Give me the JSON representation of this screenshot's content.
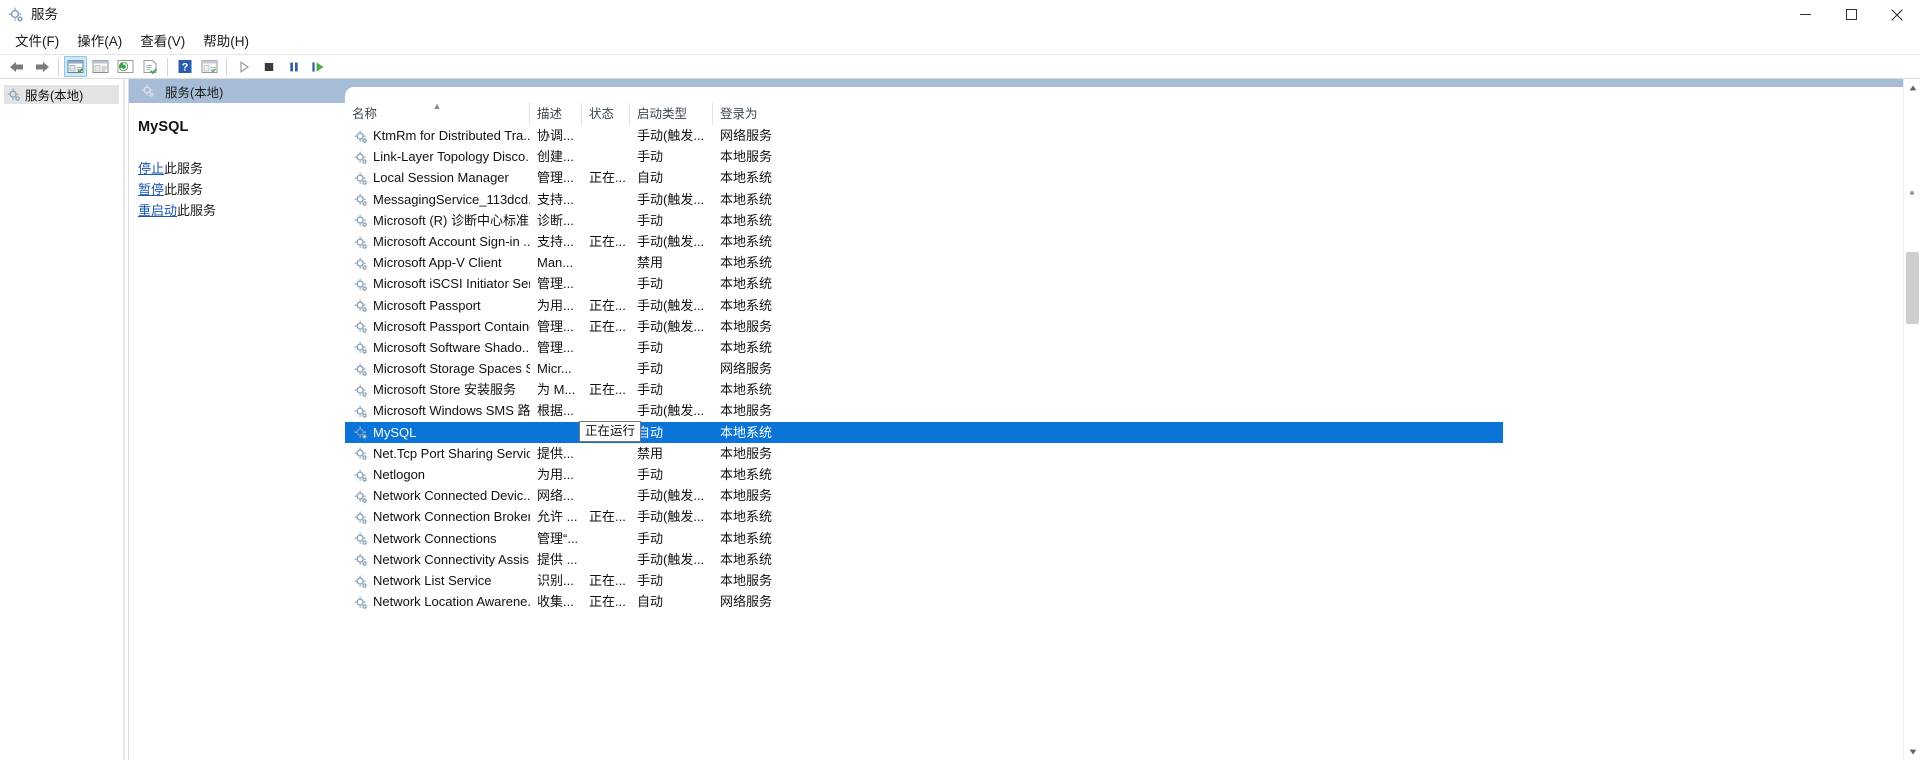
{
  "window": {
    "title": "服务",
    "icon": "services-gear-icon",
    "controls": {
      "minimize": "最小化",
      "maximize": "最大化",
      "close": "关闭"
    }
  },
  "menubar": {
    "items": [
      {
        "label": "文件(F)",
        "name": "menu-file"
      },
      {
        "label": "操作(A)",
        "name": "menu-action"
      },
      {
        "label": "查看(V)",
        "name": "menu-view"
      },
      {
        "label": "帮助(H)",
        "name": "menu-help"
      }
    ]
  },
  "toolbar": {
    "buttons": [
      {
        "name": "back-icon",
        "kind": "arrow-left"
      },
      {
        "name": "forward-icon",
        "kind": "arrow-right"
      },
      {
        "name": "show-hide-tree-icon",
        "kind": "console-window",
        "active": true
      },
      {
        "name": "properties-icon",
        "kind": "properties"
      },
      {
        "name": "refresh-icon",
        "kind": "refresh"
      },
      {
        "name": "export-list-icon",
        "kind": "export"
      },
      {
        "name": "help-icon",
        "kind": "help"
      },
      {
        "name": "details-view-icon",
        "kind": "console-window"
      },
      {
        "name": "start-service-icon",
        "kind": "play"
      },
      {
        "name": "stop-service-icon",
        "kind": "stop"
      },
      {
        "name": "pause-service-icon",
        "kind": "pause"
      },
      {
        "name": "restart-service-icon",
        "kind": "restart"
      }
    ]
  },
  "tree": {
    "root": {
      "label": "服务(本地)",
      "icon": "services-gear-icon",
      "selected": true
    }
  },
  "details": {
    "header": {
      "label": "服务(本地)",
      "icon": "services-gear-icon"
    },
    "service_name": "MySQL",
    "links": [
      {
        "link_text": "停止",
        "suffix": "此服务",
        "name": "stop-service-link"
      },
      {
        "link_text": "暂停",
        "suffix": "此服务",
        "name": "pause-service-link"
      },
      {
        "link_text": "重启动",
        "suffix": "此服务",
        "name": "restart-service-link"
      }
    ]
  },
  "list": {
    "columns": [
      {
        "label": "名称",
        "name": "column-name",
        "sorted": true,
        "sort_direction": "asc"
      },
      {
        "label": "描述",
        "name": "column-description",
        "sorted": false
      },
      {
        "label": "状态",
        "name": "column-status",
        "sorted": false
      },
      {
        "label": "启动类型",
        "name": "column-startup-type",
        "sorted": false
      },
      {
        "label": "登录为",
        "name": "column-log-on-as",
        "sorted": false
      }
    ],
    "tooltip": "正在运行",
    "rows": [
      {
        "name": "KtmRm for Distributed Tra...",
        "description": "协调...",
        "status": "",
        "startup": "手动(触发...",
        "logon": "网络服务"
      },
      {
        "name": "Link-Layer Topology Disco...",
        "description": "创建...",
        "status": "",
        "startup": "手动",
        "logon": "本地服务"
      },
      {
        "name": "Local Session Manager",
        "description": "管理...",
        "status": "正在...",
        "startup": "自动",
        "logon": "本地系统"
      },
      {
        "name": "MessagingService_113dcd...",
        "description": "支持...",
        "status": "",
        "startup": "手动(触发...",
        "logon": "本地系统"
      },
      {
        "name": "Microsoft (R) 诊断中心标准...",
        "description": "诊断...",
        "status": "",
        "startup": "手动",
        "logon": "本地系统"
      },
      {
        "name": "Microsoft Account Sign-in ...",
        "description": "支持...",
        "status": "正在...",
        "startup": "手动(触发...",
        "logon": "本地系统"
      },
      {
        "name": "Microsoft App-V Client",
        "description": "Man...",
        "status": "",
        "startup": "禁用",
        "logon": "本地系统"
      },
      {
        "name": "Microsoft iSCSI Initiator Ser...",
        "description": "管理...",
        "status": "",
        "startup": "手动",
        "logon": "本地系统"
      },
      {
        "name": "Microsoft Passport",
        "description": "为用...",
        "status": "正在...",
        "startup": "手动(触发...",
        "logon": "本地系统"
      },
      {
        "name": "Microsoft Passport Container",
        "description": "管理...",
        "status": "正在...",
        "startup": "手动(触发...",
        "logon": "本地服务"
      },
      {
        "name": "Microsoft Software Shado...",
        "description": "管理...",
        "status": "",
        "startup": "手动",
        "logon": "本地系统"
      },
      {
        "name": "Microsoft Storage Spaces S...",
        "description": "Micr...",
        "status": "",
        "startup": "手动",
        "logon": "网络服务"
      },
      {
        "name": "Microsoft Store 安装服务",
        "description": "为 M...",
        "status": "正在...",
        "startup": "手动",
        "logon": "本地系统"
      },
      {
        "name": "Microsoft Windows SMS 路...",
        "description": "根据...",
        "status": "",
        "startup": "手动(触发...",
        "logon": "本地服务"
      },
      {
        "name": "MySQL",
        "description": "",
        "status": "",
        "startup": "自动",
        "logon": "本地系统",
        "selected": true
      },
      {
        "name": "Net.Tcp Port Sharing Service",
        "description": "提供...",
        "status": "",
        "startup": "禁用",
        "logon": "本地服务"
      },
      {
        "name": "Netlogon",
        "description": "为用...",
        "status": "",
        "startup": "手动",
        "logon": "本地系统"
      },
      {
        "name": "Network Connected Devic...",
        "description": "网络...",
        "status": "",
        "startup": "手动(触发...",
        "logon": "本地服务"
      },
      {
        "name": "Network Connection Broker",
        "description": "允许 ...",
        "status": "正在...",
        "startup": "手动(触发...",
        "logon": "本地系统"
      },
      {
        "name": "Network Connections",
        "description": "管理“...",
        "status": "",
        "startup": "手动",
        "logon": "本地系统"
      },
      {
        "name": "Network Connectivity Assis...",
        "description": "提供 ...",
        "status": "",
        "startup": "手动(触发...",
        "logon": "本地系统"
      },
      {
        "name": "Network List Service",
        "description": "识别...",
        "status": "正在...",
        "startup": "手动",
        "logon": "本地服务"
      },
      {
        "name": "Network Location Awarene...",
        "description": "收集...",
        "status": "正在...",
        "startup": "自动",
        "logon": "网络服务"
      }
    ]
  },
  "colors": {
    "selection_blue": "#0a74d8",
    "band_blue": "#a7bcd6",
    "link_blue": "#1a55b0",
    "tree_selected_gray": "#e3e3e3",
    "toolbar_active": "#cde8f6"
  }
}
